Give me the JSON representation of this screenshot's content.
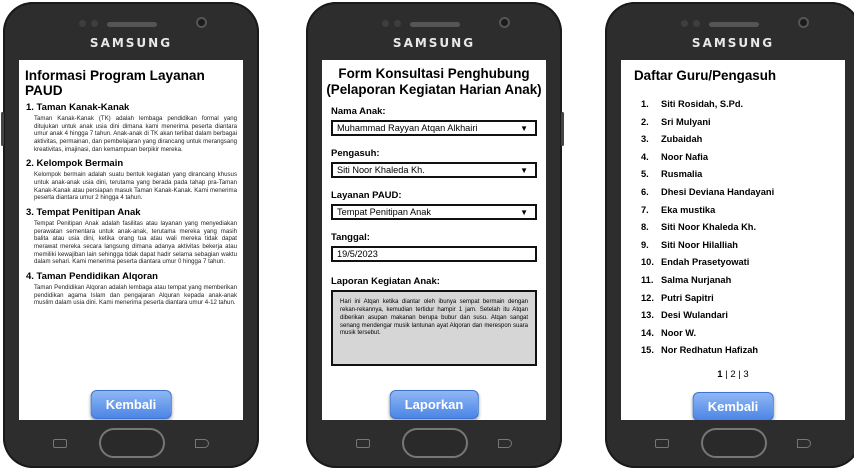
{
  "phones": {
    "brand": "SAMSUNG"
  },
  "screen1": {
    "title": "Informasi Program Layanan PAUD",
    "sections": [
      {
        "heading": "1. Taman Kanak-Kanak",
        "text": "Taman Kanak-Kanak (TK) adalah lembaga pendidikan formal yang ditujukan untuk anak usia dini dimana kami menerima peserta diantara umur anak 4 hingga 7 tahun. Anak-anak di TK akan terlibat dalam berbagai aktivitas, permainan, dan pembelajaran yang dirancang untuk merangsang kreativitas, imajinasi, dan kemampuan berpikir mereka."
      },
      {
        "heading": "2. Kelompok Bermain",
        "text": "Kelompok bermain adalah suatu bentuk kegiatan yang dirancang khusus untuk anak-anak usia dini, terutama yang berada pada tahap pra-Taman Kanak-Kanak atau persiapan masuk Taman Kanak-Kanak. Kami menerima peserta diantara umur 2 hingga 4 tahun."
      },
      {
        "heading": "3. Tempat Penitipan Anak",
        "text": "Tempat Penitipan Anak adalah fasilitas atau layanan yang menyediakan perawatan sementara untuk anak-anak, terutama mereka yang masih balita atau usia dini, ketika orang tua atau wali mereka tidak dapat merawat mereka secara langsung dimana adanya aktivitas bekerja atau memiliki kewajiban lain sehingga tidak dapat hadir selama sebagian waktu dalam sehari. Kami menerima peserta diantara umur 0 hingga 7 tahun."
      },
      {
        "heading": "4. Taman Pendidikan Alqoran",
        "text": "Taman Pendidikan Alqoran adalah lembaga atau tempat yang memberikan pendidikan agama Islam dan pengajaran Alquran kepada anak-anak muslim dalam usia dini. Kami menerima peserta diantara umur 4-12 tahun."
      }
    ],
    "button": "Kembali"
  },
  "screen2": {
    "title": "Form Konsultasi Penghubung (Pelaporan Kegiatan Harian Anak)",
    "fields": {
      "nama_label": "Nama Anak:",
      "nama_value": "Muhammad Rayyan Atqan Alkhairi",
      "pengasuh_label": "Pengasuh:",
      "pengasuh_value": "Siti Noor Khaleda Kh.",
      "layanan_label": "Layanan PAUD:",
      "layanan_value": "Tempat Penitipan Anak",
      "tanggal_label": "Tanggal:",
      "tanggal_value": "19/5/2023",
      "laporan_label": "Laporan Kegiatan Anak:",
      "laporan_value": "Hari ini Atqan ketika diantar oleh ibunya sempat bermain dengan rekan-rekannya, kemudian tertidur hampir 1 jam. Setelah itu Atqan diberikan asupan makanan berupa bubur dan susu. Atqan sangat senang mendengar musik lantunan ayat Alqoran dan merespon suara musik tersebut."
    },
    "dropdown_glyph": "▼",
    "button": "Laporkan"
  },
  "screen3": {
    "title": "Daftar Guru/Pengasuh",
    "items": [
      {
        "num": "1.",
        "name": "Siti Rosidah, S.Pd."
      },
      {
        "num": "2.",
        "name": "Sri Mulyani"
      },
      {
        "num": "3.",
        "name": "Zubaidah"
      },
      {
        "num": "4.",
        "name": "Noor Nafia"
      },
      {
        "num": "5.",
        "name": "Rusmalia"
      },
      {
        "num": "6.",
        "name": "Dhesi Deviana Handayani"
      },
      {
        "num": "7.",
        "name": "Eka mustika"
      },
      {
        "num": "8.",
        "name": "Siti Noor Khaleda Kh."
      },
      {
        "num": "9.",
        "name": "Siti Noor Hilalliah"
      },
      {
        "num": "10.",
        "name": "Endah Prasetyowati"
      },
      {
        "num": "11.",
        "name": "Salma Nurjanah"
      },
      {
        "num": "12.",
        "name": "Putri Sapitri"
      },
      {
        "num": "13.",
        "name": "Desi Wulandari"
      },
      {
        "num": "14.",
        "name": "Noor W."
      },
      {
        "num": "15.",
        "name": "Nor Redhatun Hafizah"
      }
    ],
    "pagination": {
      "p1": "1",
      "sep1": " | ",
      "p2": "2",
      "sep2": " | ",
      "p3": "3"
    },
    "button": "Kembali"
  }
}
